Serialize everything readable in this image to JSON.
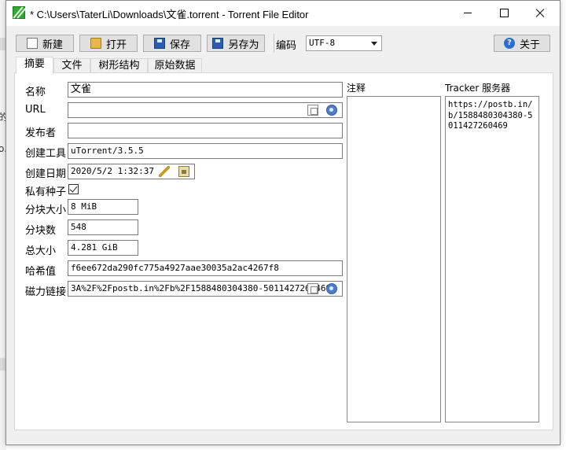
{
  "background": {
    "glyphs": [
      "的",
      "o."
    ]
  },
  "window": {
    "title": "* C:\\Users\\TaterLi\\Downloads\\文雀.torrent - Torrent File Editor"
  },
  "toolbar": {
    "new_label": "新建",
    "open_label": "打开",
    "save_label": "保存",
    "saveas_label": "另存为",
    "encoding_label": "编码",
    "encoding_value": "UTF-8",
    "about_label": "关于"
  },
  "tabs": [
    "摘要",
    "文件",
    "树形结构",
    "原始数据"
  ],
  "summary": {
    "name_label": "名称",
    "name_value": "文雀",
    "url_label": "URL",
    "url_value": "",
    "publisher_label": "发布者",
    "publisher_value": "",
    "tool_label": "创建工具",
    "tool_value": "uTorrent/3.5.5",
    "date_label": "创建日期",
    "date_value": "2020/5/2 1:32:37",
    "private_label": "私有种子",
    "private_checked": true,
    "piece_size_label": "分块大小",
    "piece_size_value": "8 MiB",
    "piece_count_label": "分块数",
    "piece_count_value": "548",
    "total_size_label": "总大小",
    "total_size_value": "4.281 GiB",
    "hash_label": "哈希值",
    "hash_value": "f6ee672da290fc775a4927aae30035a2ac4267f8",
    "magnet_label": "磁力链接",
    "magnet_value": "3A%2F%2Fpostb.in%2Fb%2F1588480304380-5011427260469"
  },
  "comment": {
    "label": "注释",
    "value": ""
  },
  "tracker": {
    "label": "Tracker 服务器",
    "value": "https://postb.in/b/1588480304380-5011427260469"
  }
}
